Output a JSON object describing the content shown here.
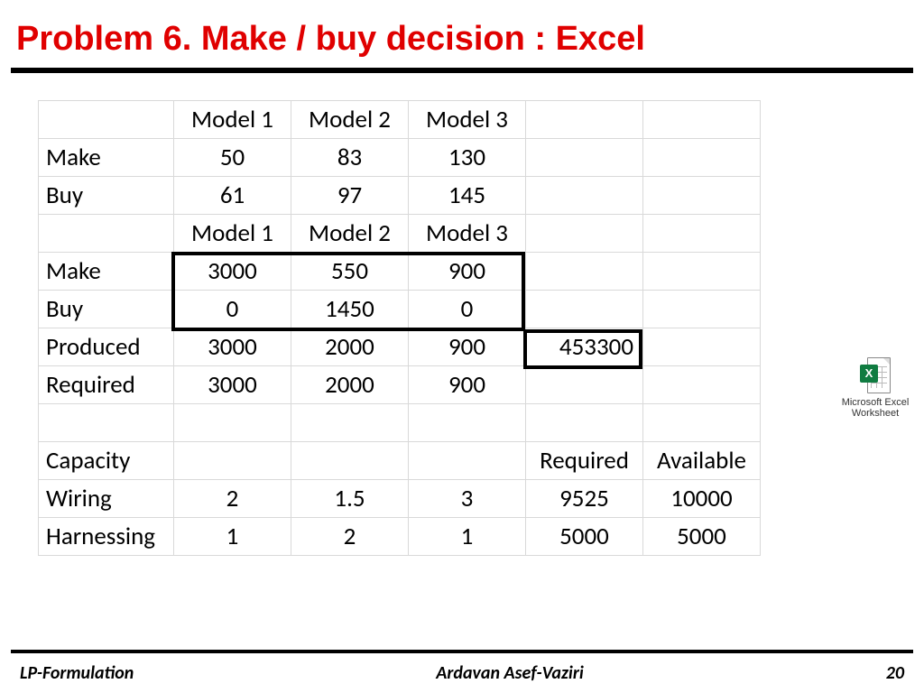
{
  "header": {
    "title": "Problem 6. Make / buy decision : Excel"
  },
  "table": {
    "headers": [
      "Model 1",
      "Model 2",
      "Model 3"
    ],
    "cost_rows": [
      {
        "label": "Make",
        "v": [
          "50",
          "83",
          "130"
        ]
      },
      {
        "label": "Buy",
        "v": [
          "61",
          "97",
          "145"
        ]
      }
    ],
    "headers2": [
      "Model 1",
      "Model 2",
      "Model 3"
    ],
    "decision_rows": [
      {
        "label": "Make",
        "v": [
          "3000",
          "550",
          "900"
        ]
      },
      {
        "label": "Buy",
        "v": [
          "0",
          "1450",
          "0"
        ]
      }
    ],
    "produced": {
      "label": "Produced",
      "v": [
        "3000",
        "2000",
        "900"
      ],
      "total": "453300"
    },
    "required": {
      "label": "Required",
      "v": [
        "3000",
        "2000",
        "900"
      ]
    },
    "capacity_header": {
      "label": "Capacity",
      "req": "Required",
      "avail": "Available"
    },
    "capacity_rows": [
      {
        "label": "Wiring",
        "v": [
          "2",
          "1.5",
          "3"
        ],
        "req": "9525",
        "avail": "10000"
      },
      {
        "label": "Harnessing",
        "v": [
          "1",
          "2",
          "1"
        ],
        "req": "5000",
        "avail": "5000"
      }
    ]
  },
  "excel_label": "Microsoft Excel Worksheet",
  "footer": {
    "left": "LP-Formulation",
    "center": "Ardavan Asef-Vaziri",
    "page": "20"
  }
}
